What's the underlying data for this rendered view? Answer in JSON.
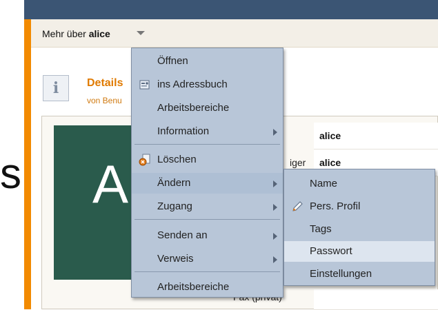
{
  "header": {
    "prefix": "Mehr über",
    "user": "alice"
  },
  "section": {
    "title": "Details",
    "subtitle": "von Benu",
    "avatar_letter": "A",
    "cut_text": "s"
  },
  "table": {
    "rows": [
      {
        "label": "",
        "value": "alice"
      },
      {
        "label": "iger",
        "value": "alice"
      },
      {
        "label": "Fax (privat)",
        "value": ""
      }
    ]
  },
  "menu": {
    "items": [
      {
        "label": "Öffnen"
      },
      {
        "label": "ins Adressbuch",
        "icon": "address-book-icon"
      },
      {
        "label": "Arbeitsbereiche"
      },
      {
        "label": "Information",
        "submenu": true
      },
      {
        "label": "Löschen",
        "icon": "delete-icon"
      },
      {
        "label": "Ändern",
        "submenu": true
      },
      {
        "label": "Zugang",
        "submenu": true
      },
      {
        "label": "Senden an",
        "submenu": true
      },
      {
        "label": "Verweis",
        "submenu": true
      },
      {
        "label": "Arbeitsbereiche"
      }
    ]
  },
  "submenu": {
    "items": [
      {
        "label": "Name"
      },
      {
        "label": "Pers. Profil",
        "icon": "pencil-icon"
      },
      {
        "label": "Tags"
      },
      {
        "label": "Passwort"
      },
      {
        "label": "Einstellungen"
      }
    ]
  },
  "colors": {
    "topbar": "#3b5574",
    "accent": "#f28a00",
    "menu_bg": "#b8c6d8",
    "avatar_bg": "#2a5b4c"
  }
}
